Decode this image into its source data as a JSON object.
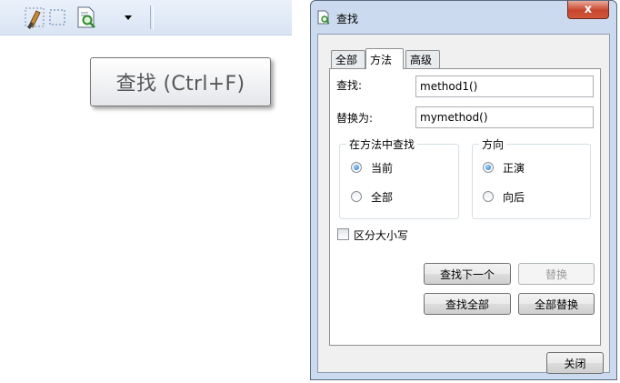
{
  "toolbar": {
    "icons": [
      "brush-icon",
      "select-region-icon",
      "find-document-icon",
      "dropdown-arrow-icon"
    ]
  },
  "tooltip": {
    "text": "查找 (Ctrl+F)"
  },
  "dialog": {
    "title": "查找",
    "close_label": "x",
    "tabs": [
      {
        "label": "全部",
        "active": false
      },
      {
        "label": "方法",
        "active": true
      },
      {
        "label": "高级",
        "active": false
      }
    ],
    "find_label": "查找:",
    "find_value": "method1()",
    "replace_label": "替换为:",
    "replace_value": "mymethod()",
    "scope_group": {
      "title": "在方法中查找",
      "options": [
        {
          "label": "当前",
          "checked": true
        },
        {
          "label": "全部",
          "checked": false
        }
      ]
    },
    "direction_group": {
      "title": "方向",
      "options": [
        {
          "label": "正演",
          "checked": true
        },
        {
          "label": "向后",
          "checked": false
        }
      ]
    },
    "match_case": {
      "label": "区分大小写",
      "checked": false
    },
    "buttons": {
      "find_next": "查找下一个",
      "replace": "替换",
      "find_all": "查找全部",
      "replace_all": "全部替换",
      "close": "关闭"
    }
  },
  "colors": {
    "dialog_frame": "#cbdaee",
    "close_button": "#c7452c",
    "radio_selected": "#1f6fc5"
  }
}
